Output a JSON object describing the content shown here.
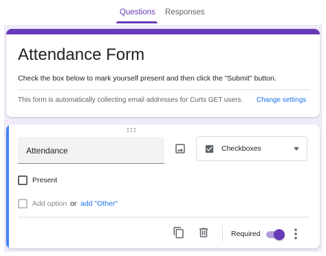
{
  "tabs": [
    {
      "label": "Questions",
      "active": true
    },
    {
      "label": "Responses",
      "active": false
    }
  ],
  "form": {
    "title": "Attendance Form",
    "description": "Check the box below to mark yourself present and then click the \"Submit\" button.",
    "collect_note": "This form is automatically collecting email addresses for Curts GET users.",
    "change_settings_label": "Change settings"
  },
  "question": {
    "title": "Attendance",
    "type_label": "Checkboxes",
    "options": [
      {
        "label": "Present"
      }
    ],
    "add_option_label": "Add option",
    "or_label": "or",
    "add_other_label": "add \"Other\"",
    "required_label": "Required",
    "required": true
  },
  "colors": {
    "accent": "#673ab7",
    "active_question": "#4285f4",
    "link": "#1a73e8",
    "background": "#f0ebf8"
  },
  "icons": {
    "drag": "drag-handle-icon",
    "image": "image-icon",
    "type": "checkbox-checked-icon",
    "dropdown": "caret-down-icon",
    "copy": "duplicate-icon",
    "delete": "trash-icon",
    "more": "more-vertical-icon"
  }
}
